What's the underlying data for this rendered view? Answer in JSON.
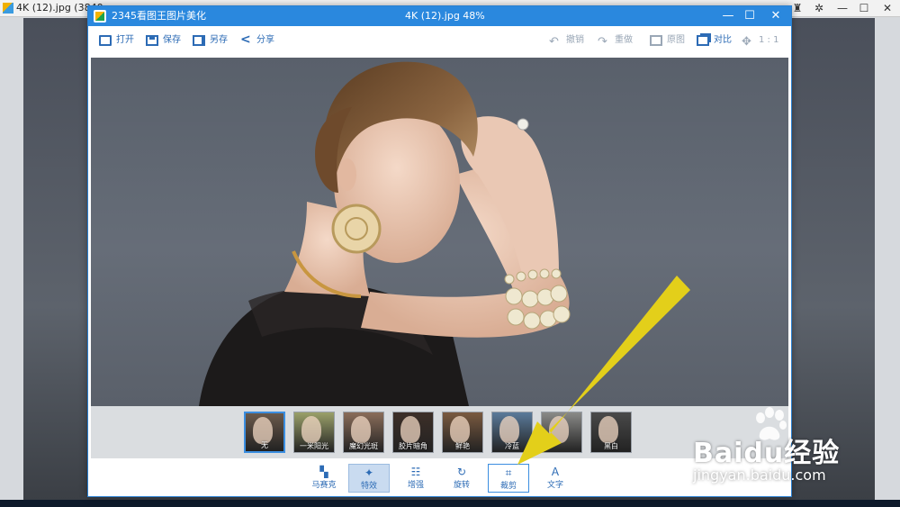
{
  "background_window": {
    "title": "4K (12).jpg  (3840"
  },
  "dialog": {
    "app_name": "2345看图王图片美化",
    "file_title": "4K (12).jpg  48%",
    "controls": {
      "minimize": "—",
      "maximize": "☐",
      "close": "✕"
    }
  },
  "toolbar": {
    "open": "打开",
    "save": "保存",
    "save_as": "另存",
    "share": "分享",
    "undo": "撤销",
    "redo": "重做",
    "original": "原图",
    "compare": "对比",
    "ratio": "1 : 1"
  },
  "filters": [
    {
      "label": "无",
      "tint": "#6b5a4c",
      "selected": true
    },
    {
      "label": "一米阳光",
      "tint": "#9aa06a",
      "selected": false
    },
    {
      "label": "魔幻光斑",
      "tint": "#8a6d5a",
      "selected": false
    },
    {
      "label": "胶片暗角",
      "tint": "#3d2f28",
      "selected": false
    },
    {
      "label": "鲜艳",
      "tint": "#7a5a40",
      "selected": false
    },
    {
      "label": "冷蓝",
      "tint": "#5a7a9a",
      "selected": false
    },
    {
      "label": "",
      "tint": "#8a8a88",
      "selected": false
    },
    {
      "label": "黑白",
      "tint": "#4a4a4a",
      "selected": false
    }
  ],
  "bottom_tools": {
    "mosaic": "马赛克",
    "effects": "特效",
    "enhance": "增强",
    "rotate": "旋转",
    "crop": "裁剪",
    "text": "文字"
  },
  "watermark": {
    "brand": "Baidu经验",
    "domain": "jingyan.baidu.com"
  },
  "colors": {
    "title_bar": "#2a88de",
    "accent": "#2c6bb5",
    "arrow": "#e3cf1a"
  }
}
